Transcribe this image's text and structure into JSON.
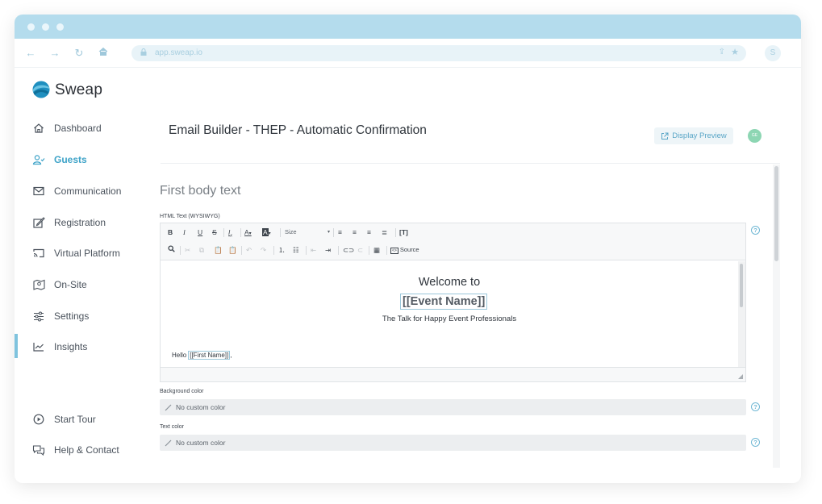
{
  "browser": {
    "url": "app.sweap.io",
    "profile_initial": "S"
  },
  "brand": {
    "name": "Sweap",
    "color": "#2b9cc9"
  },
  "sidebar": {
    "items": [
      {
        "label": "Dashboard",
        "icon": "home-icon"
      },
      {
        "label": "Guests",
        "icon": "guests-icon",
        "active": true
      },
      {
        "label": "Communication",
        "icon": "mail-icon"
      },
      {
        "label": "Registration",
        "icon": "edit-form-icon"
      },
      {
        "label": "Virtual Platform",
        "icon": "cast-icon"
      },
      {
        "label": "On-Site",
        "icon": "map-icon"
      },
      {
        "label": "Settings",
        "icon": "sliders-icon"
      },
      {
        "label": "Insights",
        "icon": "chart-line-icon"
      }
    ],
    "footer": [
      {
        "label": "Start Tour",
        "icon": "play-circle-icon"
      },
      {
        "label": "Help & Contact",
        "icon": "chat-icon"
      }
    ]
  },
  "header": {
    "title": "Email Builder - THEP - Automatic Confirmation",
    "preview_label": "Display Preview",
    "avatar_initials": "GE"
  },
  "section": {
    "title": "First body text",
    "html_label": "HTML Text (WYSIWYG)"
  },
  "toolbar": {
    "row1": [
      "B",
      "I",
      "U",
      "S",
      "Tx",
      "A",
      "A",
      "Size"
    ],
    "size_label": "Size",
    "source_label": "Source"
  },
  "editor": {
    "welcome": "Welcome to",
    "event_name": "[[Event Name]]",
    "tagline": "The Talk for Happy Event Professionals",
    "hello": "Hello",
    "first_name": "[[First Name]]",
    "hello_suffix": ","
  },
  "colors": {
    "background_label": "Background color",
    "background_value": "No custom color",
    "text_label": "Text color",
    "text_value": "No custom color"
  },
  "accent": "#3ea3c8"
}
